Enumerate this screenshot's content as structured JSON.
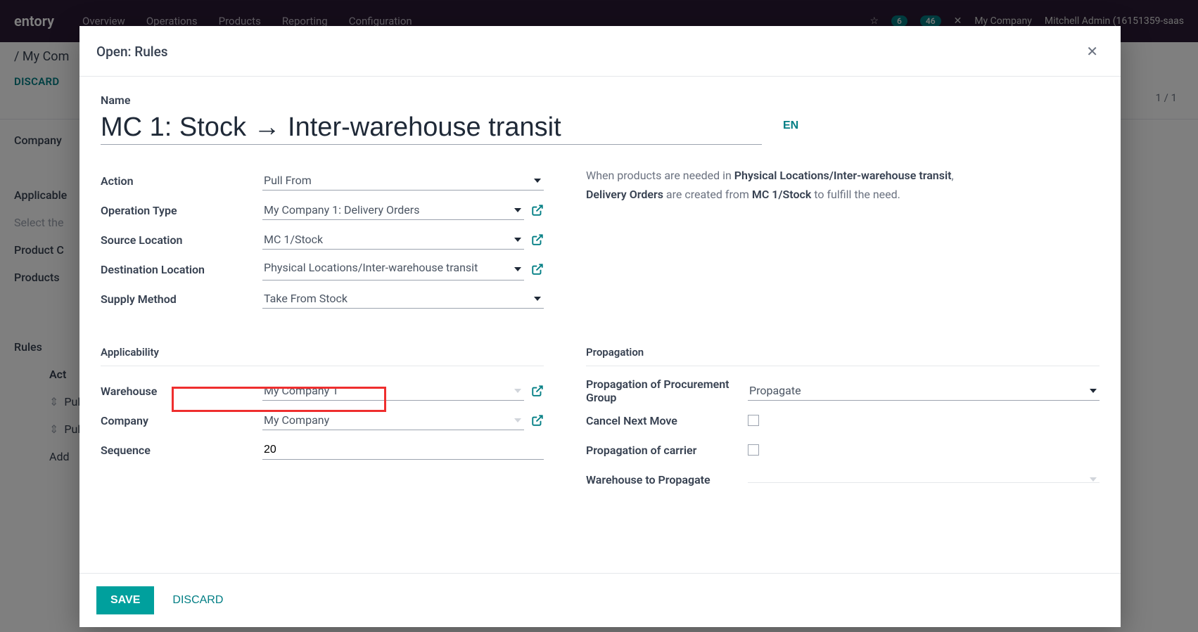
{
  "topnav": {
    "brand": "entory",
    "items": [
      "Overview",
      "Operations",
      "Products",
      "Reporting",
      "Configuration"
    ],
    "badge1": "6",
    "badge2": "46",
    "company": "My Company",
    "user": "Mitchell Admin (16151359-saas"
  },
  "subheader": {
    "breadcrumb": "/ My Com",
    "discard": "DISCARD",
    "pagecount": "1 / 1"
  },
  "bgbody": {
    "l1": "Company",
    "l2": "Applicable",
    "l3": "Select the",
    "l4": "Product C",
    "l5": "Products",
    "rules_title": "Rules",
    "col_action": "Act",
    "row1": "Pul",
    "row2": "Pul",
    "row_add": "Add"
  },
  "modal": {
    "title": "Open: Rules",
    "name_label": "Name",
    "name_value": "MC 1: Stock → Inter-warehouse transit",
    "lang": "EN",
    "labels": {
      "action": "Action",
      "operation_type": "Operation Type",
      "source_location": "Source Location",
      "destination_location": "Destination Location",
      "supply_method": "Supply Method",
      "applicability": "Applicability",
      "warehouse": "Warehouse",
      "company": "Company",
      "sequence": "Sequence",
      "propagation": "Propagation",
      "prop_group": "Propagation of Procurement Group",
      "cancel_next": "Cancel Next Move",
      "prop_carrier": "Propagation of carrier",
      "wh_to_prop": "Warehouse to Propagate"
    },
    "values": {
      "action": "Pull From",
      "operation_type": "My Company 1: Delivery Orders",
      "source_location": "MC 1/Stock",
      "destination_location": "Physical Locations/Inter-warehouse transit",
      "supply_method": "Take From Stock",
      "warehouse": "My Company 1",
      "company": "My Company",
      "sequence": "20",
      "prop_group": "Propagate",
      "wh_to_prop": ""
    },
    "desc": {
      "p1a": "When products are needed in ",
      "p1b": "Physical Locations/Inter-warehouse transit",
      "p1c": ",",
      "p2a": "Delivery Orders",
      "p2b": " are created from ",
      "p2c": "MC 1/Stock",
      "p2d": " to fulfill the need."
    },
    "footer": {
      "save": "SAVE",
      "discard": "DISCARD"
    }
  }
}
